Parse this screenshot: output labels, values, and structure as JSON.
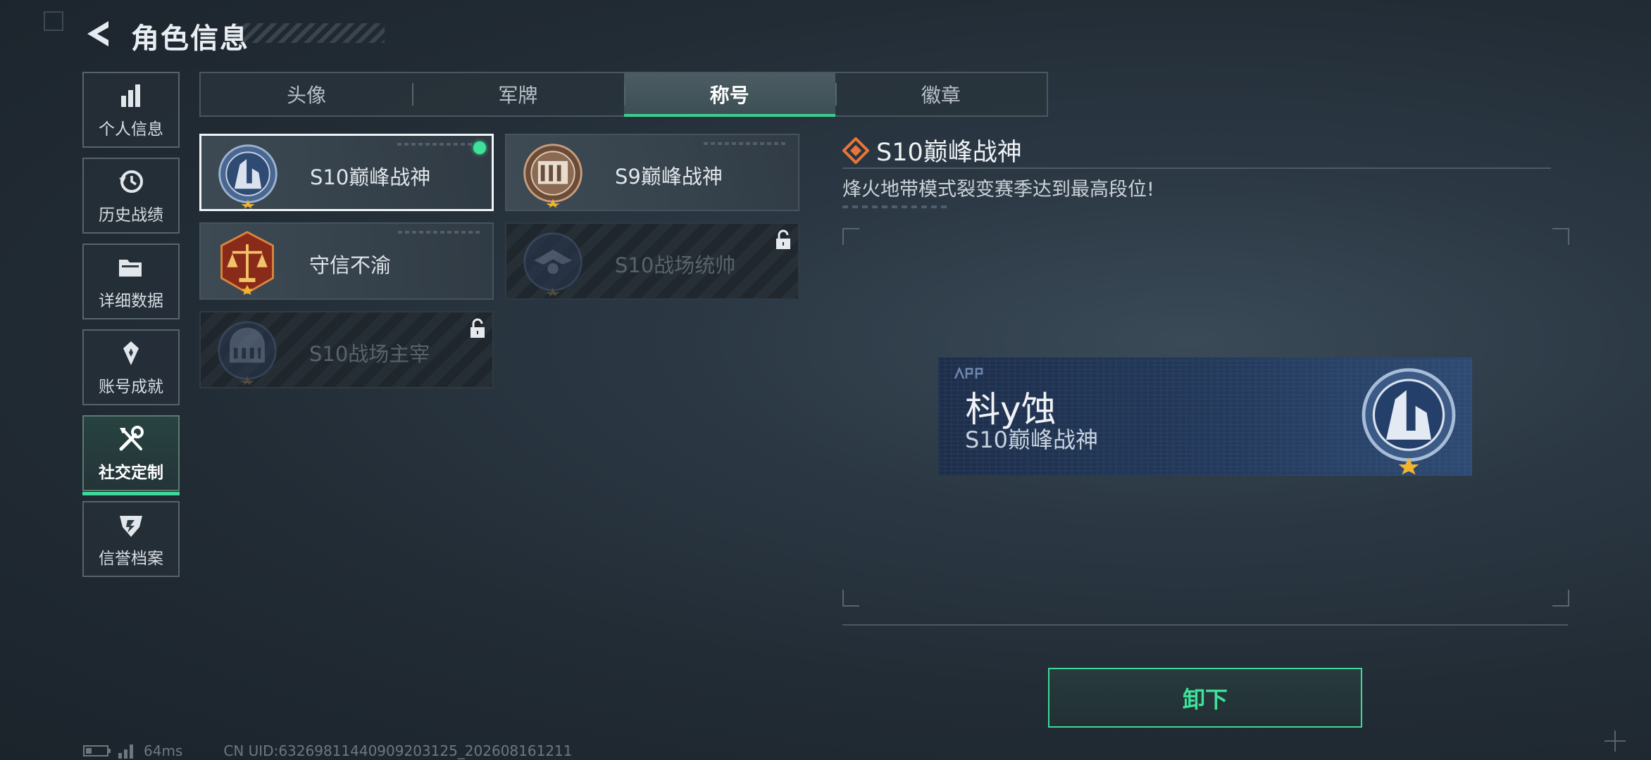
{
  "header": {
    "title": "角色信息"
  },
  "sidebar": {
    "items": [
      {
        "label": "个人信息",
        "icon": "bar-chart-icon"
      },
      {
        "label": "历史战绩",
        "icon": "history-icon"
      },
      {
        "label": "详细数据",
        "icon": "folder-icon"
      },
      {
        "label": "账号成就",
        "icon": "achievement-icon"
      },
      {
        "label": "社交定制",
        "icon": "tools-icon",
        "active": true
      },
      {
        "label": "信誉档案",
        "icon": "credit-icon"
      }
    ]
  },
  "tabs": [
    {
      "label": "头像"
    },
    {
      "label": "军牌"
    },
    {
      "label": "称号",
      "active": true
    },
    {
      "label": "徽章"
    }
  ],
  "titles": [
    {
      "name": "S10巅峰战神",
      "state": "equipped"
    },
    {
      "name": "S9巅峰战神",
      "state": "unlocked"
    },
    {
      "name": "守信不渝",
      "state": "unlocked"
    },
    {
      "name": "S10战场统帅",
      "state": "locked"
    },
    {
      "name": "S10战场主宰",
      "state": "locked"
    }
  ],
  "detail": {
    "title": "S10巅峰战神",
    "description": "烽火地带模式裂变赛季达到最高段位!"
  },
  "nameplate": {
    "player_name": "枓y蚀",
    "title": "S10巅峰战神"
  },
  "actions": {
    "unequip_label": "卸下"
  },
  "status": {
    "ping": "64ms",
    "uid": "CN UID:6326981144090920312​5_202608161211"
  },
  "colors": {
    "accent": "#3ee29b",
    "detail_icon": "#e8763a"
  }
}
